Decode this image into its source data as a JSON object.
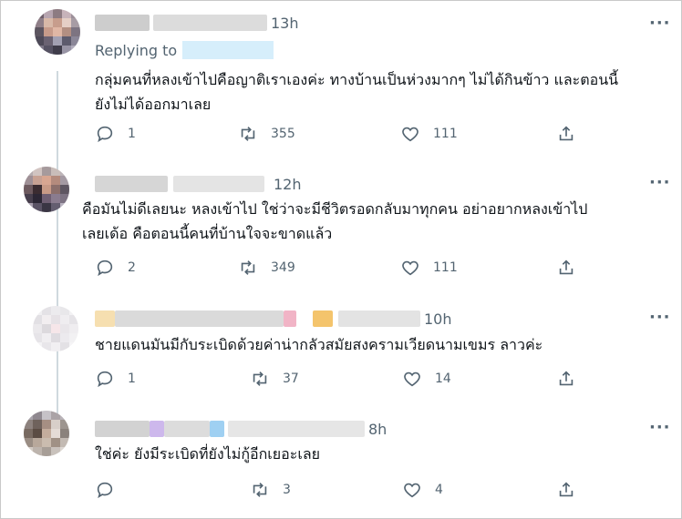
{
  "tweets": [
    {
      "time": "13h",
      "replying_label": "Replying to",
      "text_lines": [
        "กลุ่มคนที่หลงเข้าไปคือญาติเราเองค่ะ ทางบ้านเป็นห่วงมากๆ ไม่ได้กินข้าว และตอนนี้",
        "ยังไม่ได้ออกมาเลย"
      ],
      "replies": "1",
      "retweets": "355",
      "likes": "111"
    },
    {
      "time": "12h",
      "text_lines": [
        "คือมันไม่ดีเลยนะ หลงเข้าไป ใช่ว่าจะมีชีวิตรอดกลับมาทุกคน อย่าอยากหลงเข้าไป",
        "เลยเด้อ คือตอนนี้คนที่บ้านใจจะขาดแล้ว"
      ],
      "replies": "2",
      "retweets": "349",
      "likes": "111"
    },
    {
      "time": "10h",
      "text_lines": [
        "ชายแดนมันมีกับระเบิดด้วยค่าน่ากลัวสมัยสงครามเวียดนามเขมร ลาวค่ะ"
      ],
      "replies": "1",
      "retweets": "37",
      "likes": "14"
    },
    {
      "time": "8h",
      "text_lines": [
        "ใช่ค่ะ ยังมีระเบิดที่ยังไม่กู้อีกเยอะเลย"
      ],
      "replies": "",
      "retweets": "3",
      "likes": "4"
    }
  ],
  "more_glyph": "···",
  "icons": [
    "reply-icon",
    "retweet-icon",
    "like-icon",
    "share-icon",
    "more-icon"
  ],
  "colors": {
    "secondary_text": "#536471",
    "thread_line": "#cfd9de",
    "mention_placeholder": "#d6eefb"
  }
}
